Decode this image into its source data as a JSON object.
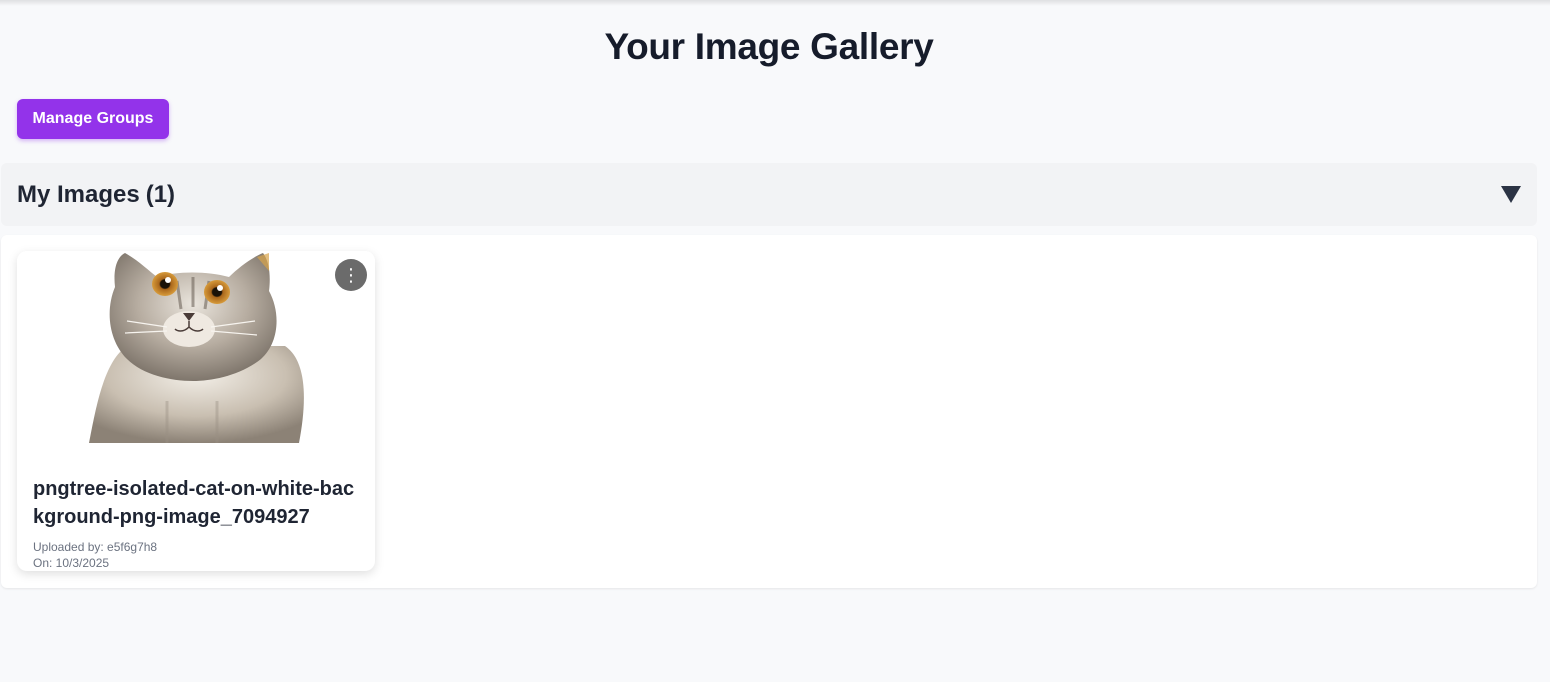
{
  "header": {
    "title": "Your Image Gallery"
  },
  "toolbar": {
    "manage_groups_label": "Manage Groups"
  },
  "section": {
    "title": "My Images",
    "count": "(1)",
    "toggle_icon": "triangle-down-icon"
  },
  "images": [
    {
      "name": "pngtree-isolated-cat-on-white-background-png-image_7094927",
      "uploaded_by": "Uploaded by: e5f6g7h8",
      "date": "On: 10/3/2025",
      "thumbnail_icon": "cat-photo",
      "menu_icon": "more-vertical-icon",
      "menu_glyph": "⋮"
    }
  ],
  "colors": {
    "accent": "#9333ea",
    "background": "#f8f9fb",
    "header_bg": "#f2f3f5"
  }
}
